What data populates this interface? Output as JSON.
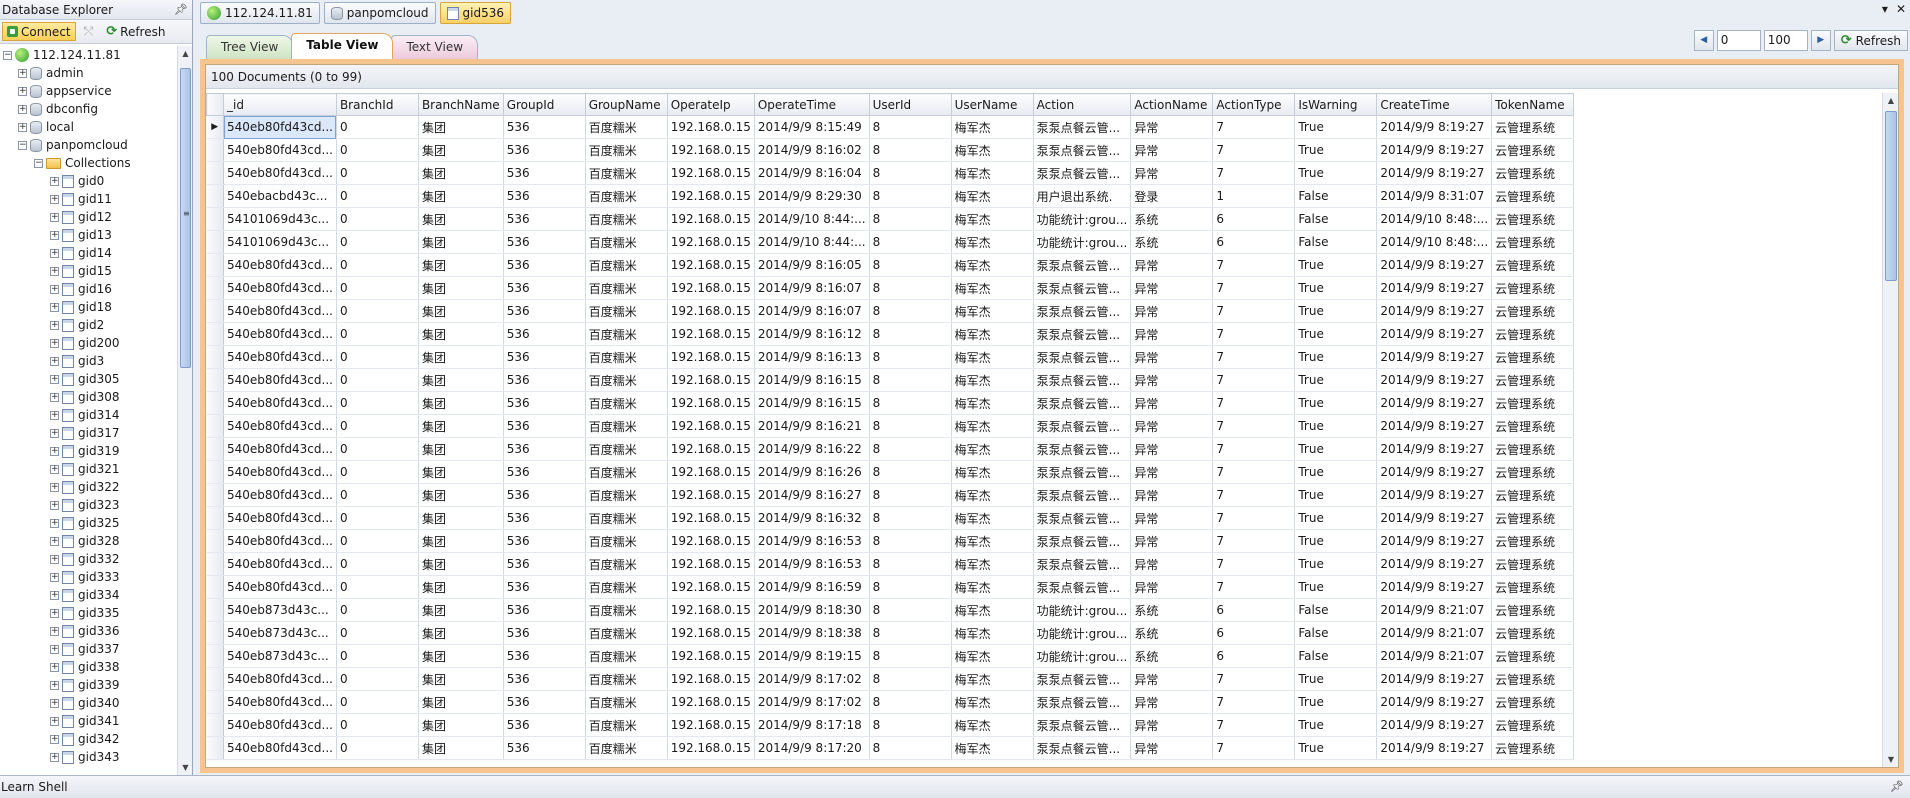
{
  "left_panel": {
    "title": "Database Explorer",
    "toolbar": {
      "connect_label": "Connect",
      "refresh_label": "Refresh"
    },
    "tree": {
      "server": "112.124.11.81",
      "databases": [
        "admin",
        "appservice",
        "dbconfig",
        "local",
        "panpomcloud"
      ],
      "collections_label": "Collections",
      "collections": [
        "gid0",
        "gid11",
        "gid12",
        "gid13",
        "gid14",
        "gid15",
        "gid16",
        "gid18",
        "gid2",
        "gid200",
        "gid3",
        "gid305",
        "gid308",
        "gid314",
        "gid317",
        "gid319",
        "gid321",
        "gid322",
        "gid323",
        "gid325",
        "gid328",
        "gid332",
        "gid333",
        "gid334",
        "gid335",
        "gid336",
        "gid337",
        "gid338",
        "gid339",
        "gid340",
        "gid341",
        "gid342",
        "gid343"
      ]
    }
  },
  "doc_tabs": [
    {
      "label": "112.124.11.81",
      "icon": "server-icon"
    },
    {
      "label": "panpomcloud",
      "icon": "database-icon"
    },
    {
      "label": "gid536",
      "icon": "collection-icon"
    }
  ],
  "view_tabs": {
    "tree": "Tree View",
    "table": "Table View",
    "text": "Text View"
  },
  "paging": {
    "skip": "0",
    "limit": "100",
    "refresh_label": "Refresh"
  },
  "doc_count": "100 Documents (0 to 99)",
  "grid": {
    "columns": [
      "_id",
      "BranchId",
      "BranchName",
      "GroupId",
      "GroupName",
      "OperateIp",
      "OperateTime",
      "UserId",
      "UserName",
      "Action",
      "ActionName",
      "ActionType",
      "IsWarning",
      "CreateTime",
      "TokenName"
    ],
    "rows": [
      [
        "540eb80fd43cd...",
        "0",
        "集团",
        "536",
        "百度糯米",
        "192.168.0.15",
        "2014/9/9 8:15:49",
        "8",
        "梅军杰",
        "泵泵点餐云管...",
        "异常",
        "7",
        "True",
        "2014/9/9 8:19:27",
        "云管理系统"
      ],
      [
        "540eb80fd43cd...",
        "0",
        "集团",
        "536",
        "百度糯米",
        "192.168.0.15",
        "2014/9/9 8:16:02",
        "8",
        "梅军杰",
        "泵泵点餐云管...",
        "异常",
        "7",
        "True",
        "2014/9/9 8:19:27",
        "云管理系统"
      ],
      [
        "540eb80fd43cd...",
        "0",
        "集团",
        "536",
        "百度糯米",
        "192.168.0.15",
        "2014/9/9 8:16:04",
        "8",
        "梅军杰",
        "泵泵点餐云管...",
        "异常",
        "7",
        "True",
        "2014/9/9 8:19:27",
        "云管理系统"
      ],
      [
        "540ebacbd43c...",
        "0",
        "集团",
        "536",
        "百度糯米",
        "192.168.0.15",
        "2014/9/9 8:29:30",
        "8",
        "梅军杰",
        "用户退出系统.",
        "登录",
        "1",
        "False",
        "2014/9/9 8:31:07",
        "云管理系统"
      ],
      [
        "54101069d43c...",
        "0",
        "集团",
        "536",
        "百度糯米",
        "192.168.0.15",
        "2014/9/10 8:44:...",
        "8",
        "梅军杰",
        "功能统计:grou...",
        "系统",
        "6",
        "False",
        "2014/9/10 8:48:...",
        "云管理系统"
      ],
      [
        "54101069d43c...",
        "0",
        "集团",
        "536",
        "百度糯米",
        "192.168.0.15",
        "2014/9/10 8:44:...",
        "8",
        "梅军杰",
        "功能统计:grou...",
        "系统",
        "6",
        "False",
        "2014/9/10 8:48:...",
        "云管理系统"
      ],
      [
        "540eb80fd43cd...",
        "0",
        "集团",
        "536",
        "百度糯米",
        "192.168.0.15",
        "2014/9/9 8:16:05",
        "8",
        "梅军杰",
        "泵泵点餐云管...",
        "异常",
        "7",
        "True",
        "2014/9/9 8:19:27",
        "云管理系统"
      ],
      [
        "540eb80fd43cd...",
        "0",
        "集团",
        "536",
        "百度糯米",
        "192.168.0.15",
        "2014/9/9 8:16:07",
        "8",
        "梅军杰",
        "泵泵点餐云管...",
        "异常",
        "7",
        "True",
        "2014/9/9 8:19:27",
        "云管理系统"
      ],
      [
        "540eb80fd43cd...",
        "0",
        "集团",
        "536",
        "百度糯米",
        "192.168.0.15",
        "2014/9/9 8:16:07",
        "8",
        "梅军杰",
        "泵泵点餐云管...",
        "异常",
        "7",
        "True",
        "2014/9/9 8:19:27",
        "云管理系统"
      ],
      [
        "540eb80fd43cd...",
        "0",
        "集团",
        "536",
        "百度糯米",
        "192.168.0.15",
        "2014/9/9 8:16:12",
        "8",
        "梅军杰",
        "泵泵点餐云管...",
        "异常",
        "7",
        "True",
        "2014/9/9 8:19:27",
        "云管理系统"
      ],
      [
        "540eb80fd43cd...",
        "0",
        "集团",
        "536",
        "百度糯米",
        "192.168.0.15",
        "2014/9/9 8:16:13",
        "8",
        "梅军杰",
        "泵泵点餐云管...",
        "异常",
        "7",
        "True",
        "2014/9/9 8:19:27",
        "云管理系统"
      ],
      [
        "540eb80fd43cd...",
        "0",
        "集团",
        "536",
        "百度糯米",
        "192.168.0.15",
        "2014/9/9 8:16:15",
        "8",
        "梅军杰",
        "泵泵点餐云管...",
        "异常",
        "7",
        "True",
        "2014/9/9 8:19:27",
        "云管理系统"
      ],
      [
        "540eb80fd43cd...",
        "0",
        "集团",
        "536",
        "百度糯米",
        "192.168.0.15",
        "2014/9/9 8:16:15",
        "8",
        "梅军杰",
        "泵泵点餐云管...",
        "异常",
        "7",
        "True",
        "2014/9/9 8:19:27",
        "云管理系统"
      ],
      [
        "540eb80fd43cd...",
        "0",
        "集团",
        "536",
        "百度糯米",
        "192.168.0.15",
        "2014/9/9 8:16:21",
        "8",
        "梅军杰",
        "泵泵点餐云管...",
        "异常",
        "7",
        "True",
        "2014/9/9 8:19:27",
        "云管理系统"
      ],
      [
        "540eb80fd43cd...",
        "0",
        "集团",
        "536",
        "百度糯米",
        "192.168.0.15",
        "2014/9/9 8:16:22",
        "8",
        "梅军杰",
        "泵泵点餐云管...",
        "异常",
        "7",
        "True",
        "2014/9/9 8:19:27",
        "云管理系统"
      ],
      [
        "540eb80fd43cd...",
        "0",
        "集团",
        "536",
        "百度糯米",
        "192.168.0.15",
        "2014/9/9 8:16:26",
        "8",
        "梅军杰",
        "泵泵点餐云管...",
        "异常",
        "7",
        "True",
        "2014/9/9 8:19:27",
        "云管理系统"
      ],
      [
        "540eb80fd43cd...",
        "0",
        "集团",
        "536",
        "百度糯米",
        "192.168.0.15",
        "2014/9/9 8:16:27",
        "8",
        "梅军杰",
        "泵泵点餐云管...",
        "异常",
        "7",
        "True",
        "2014/9/9 8:19:27",
        "云管理系统"
      ],
      [
        "540eb80fd43cd...",
        "0",
        "集团",
        "536",
        "百度糯米",
        "192.168.0.15",
        "2014/9/9 8:16:32",
        "8",
        "梅军杰",
        "泵泵点餐云管...",
        "异常",
        "7",
        "True",
        "2014/9/9 8:19:27",
        "云管理系统"
      ],
      [
        "540eb80fd43cd...",
        "0",
        "集团",
        "536",
        "百度糯米",
        "192.168.0.15",
        "2014/9/9 8:16:53",
        "8",
        "梅军杰",
        "泵泵点餐云管...",
        "异常",
        "7",
        "True",
        "2014/9/9 8:19:27",
        "云管理系统"
      ],
      [
        "540eb80fd43cd...",
        "0",
        "集团",
        "536",
        "百度糯米",
        "192.168.0.15",
        "2014/9/9 8:16:53",
        "8",
        "梅军杰",
        "泵泵点餐云管...",
        "异常",
        "7",
        "True",
        "2014/9/9 8:19:27",
        "云管理系统"
      ],
      [
        "540eb80fd43cd...",
        "0",
        "集团",
        "536",
        "百度糯米",
        "192.168.0.15",
        "2014/9/9 8:16:59",
        "8",
        "梅军杰",
        "泵泵点餐云管...",
        "异常",
        "7",
        "True",
        "2014/9/9 8:19:27",
        "云管理系统"
      ],
      [
        "540eb873d43c...",
        "0",
        "集团",
        "536",
        "百度糯米",
        "192.168.0.15",
        "2014/9/9 8:18:30",
        "8",
        "梅军杰",
        "功能统计:grou...",
        "系统",
        "6",
        "False",
        "2014/9/9 8:21:07",
        "云管理系统"
      ],
      [
        "540eb873d43c...",
        "0",
        "集团",
        "536",
        "百度糯米",
        "192.168.0.15",
        "2014/9/9 8:18:38",
        "8",
        "梅军杰",
        "功能统计:grou...",
        "系统",
        "6",
        "False",
        "2014/9/9 8:21:07",
        "云管理系统"
      ],
      [
        "540eb873d43c...",
        "0",
        "集团",
        "536",
        "百度糯米",
        "192.168.0.15",
        "2014/9/9 8:19:15",
        "8",
        "梅军杰",
        "功能统计:grou...",
        "系统",
        "6",
        "False",
        "2014/9/9 8:21:07",
        "云管理系统"
      ],
      [
        "540eb80fd43cd...",
        "0",
        "集团",
        "536",
        "百度糯米",
        "192.168.0.15",
        "2014/9/9 8:17:02",
        "8",
        "梅军杰",
        "泵泵点餐云管...",
        "异常",
        "7",
        "True",
        "2014/9/9 8:19:27",
        "云管理系统"
      ],
      [
        "540eb80fd43cd...",
        "0",
        "集团",
        "536",
        "百度糯米",
        "192.168.0.15",
        "2014/9/9 8:17:02",
        "8",
        "梅军杰",
        "泵泵点餐云管...",
        "异常",
        "7",
        "True",
        "2014/9/9 8:19:27",
        "云管理系统"
      ],
      [
        "540eb80fd43cd...",
        "0",
        "集团",
        "536",
        "百度糯米",
        "192.168.0.15",
        "2014/9/9 8:17:18",
        "8",
        "梅军杰",
        "泵泵点餐云管...",
        "异常",
        "7",
        "True",
        "2014/9/9 8:19:27",
        "云管理系统"
      ],
      [
        "540eb80fd43cd...",
        "0",
        "集团",
        "536",
        "百度糯米",
        "192.168.0.15",
        "2014/9/9 8:17:20",
        "8",
        "梅军杰",
        "泵泵点餐云管...",
        "异常",
        "7",
        "True",
        "2014/9/9 8:19:27",
        "云管理系统"
      ]
    ]
  },
  "bottom_bar": {
    "label": "Learn Shell"
  },
  "colors": {
    "accent_frame": "#f6c48f",
    "active_tab": "#f8d067",
    "selection": "#dbe8f9"
  }
}
